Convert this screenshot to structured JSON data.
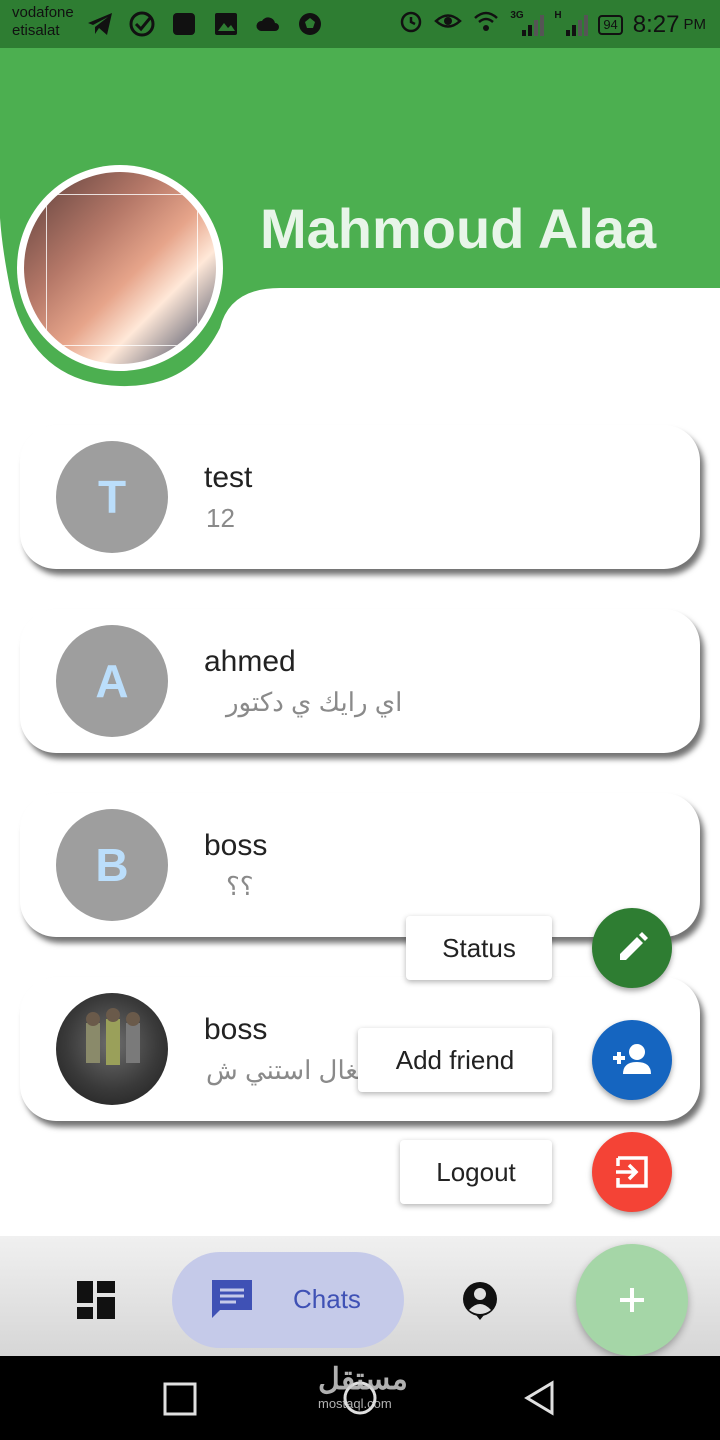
{
  "status_bar": {
    "carrier_1": "vodafone",
    "carrier_2": "etisalat",
    "battery": "94",
    "time": "8:27",
    "ampm": "PM",
    "network_1": "3G",
    "network_2": "H"
  },
  "profile": {
    "name": "Mahmoud Alaa"
  },
  "chats": [
    {
      "initial": "T",
      "name": "test",
      "last_message": "12"
    },
    {
      "initial": "A",
      "name": "ahmed",
      "last_message": "اي رايك ي دكتور"
    },
    {
      "initial": "B",
      "name": "boss",
      "last_message": "؟؟"
    },
    {
      "initial": "",
      "name": "boss",
      "last_message": "شغال استني ش"
    }
  ],
  "fab_menu": {
    "status_label": "Status",
    "add_friend_label": "Add friend",
    "logout_label": "Logout"
  },
  "bottom_nav": {
    "chats_label": "Chats"
  },
  "watermark": {
    "logo": "مستقل",
    "url": "mostaql.com"
  },
  "colors": {
    "header_green": "#4caf50",
    "status_bar_green": "#2e7d32",
    "status_fab": "#2e7d32",
    "add_friend_fab": "#1565c0",
    "logout_fab": "#f44336",
    "main_fab": "#a5d6a7",
    "chats_pill": "#c5cae9",
    "chats_accent": "#3f51b5"
  }
}
